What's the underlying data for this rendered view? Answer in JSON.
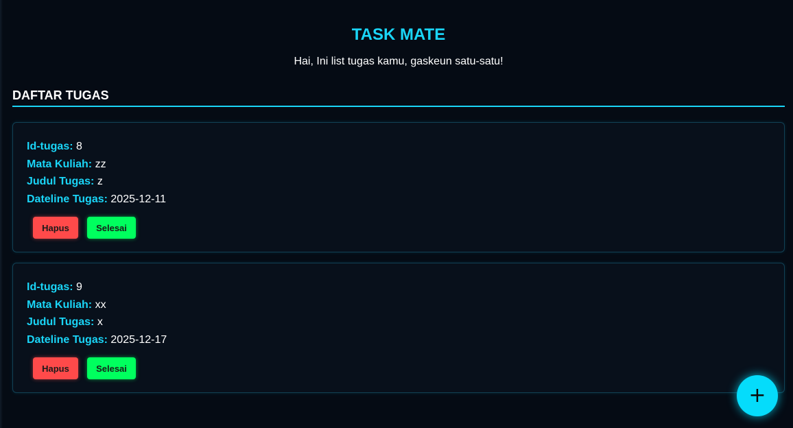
{
  "header": {
    "title": "TASK MATE",
    "subtitle": "Hai, Ini list tugas kamu, gaskeun satu-satu!"
  },
  "section": {
    "title": "DAFTAR TUGAS"
  },
  "field_labels": {
    "id": "Id-tugas:",
    "course": "Mata Kuliah:",
    "title": "Judul Tugas:",
    "deadline": "Dateline Tugas:"
  },
  "tasks": [
    {
      "id": "8",
      "course": "zz",
      "title": "z",
      "deadline": "2025-12-11",
      "delete_label": "Hapus",
      "done_label": "Selesai"
    },
    {
      "id": "9",
      "course": "xx",
      "title": "x",
      "deadline": "2025-12-17",
      "delete_label": "Hapus",
      "done_label": "Selesai"
    }
  ],
  "fab": {
    "icon": "plus-icon",
    "symbol": "+"
  },
  "colors": {
    "background": "#050b14",
    "accent": "#1ad5f7",
    "delete": "#ff4a4a",
    "done": "#00ff5e"
  }
}
